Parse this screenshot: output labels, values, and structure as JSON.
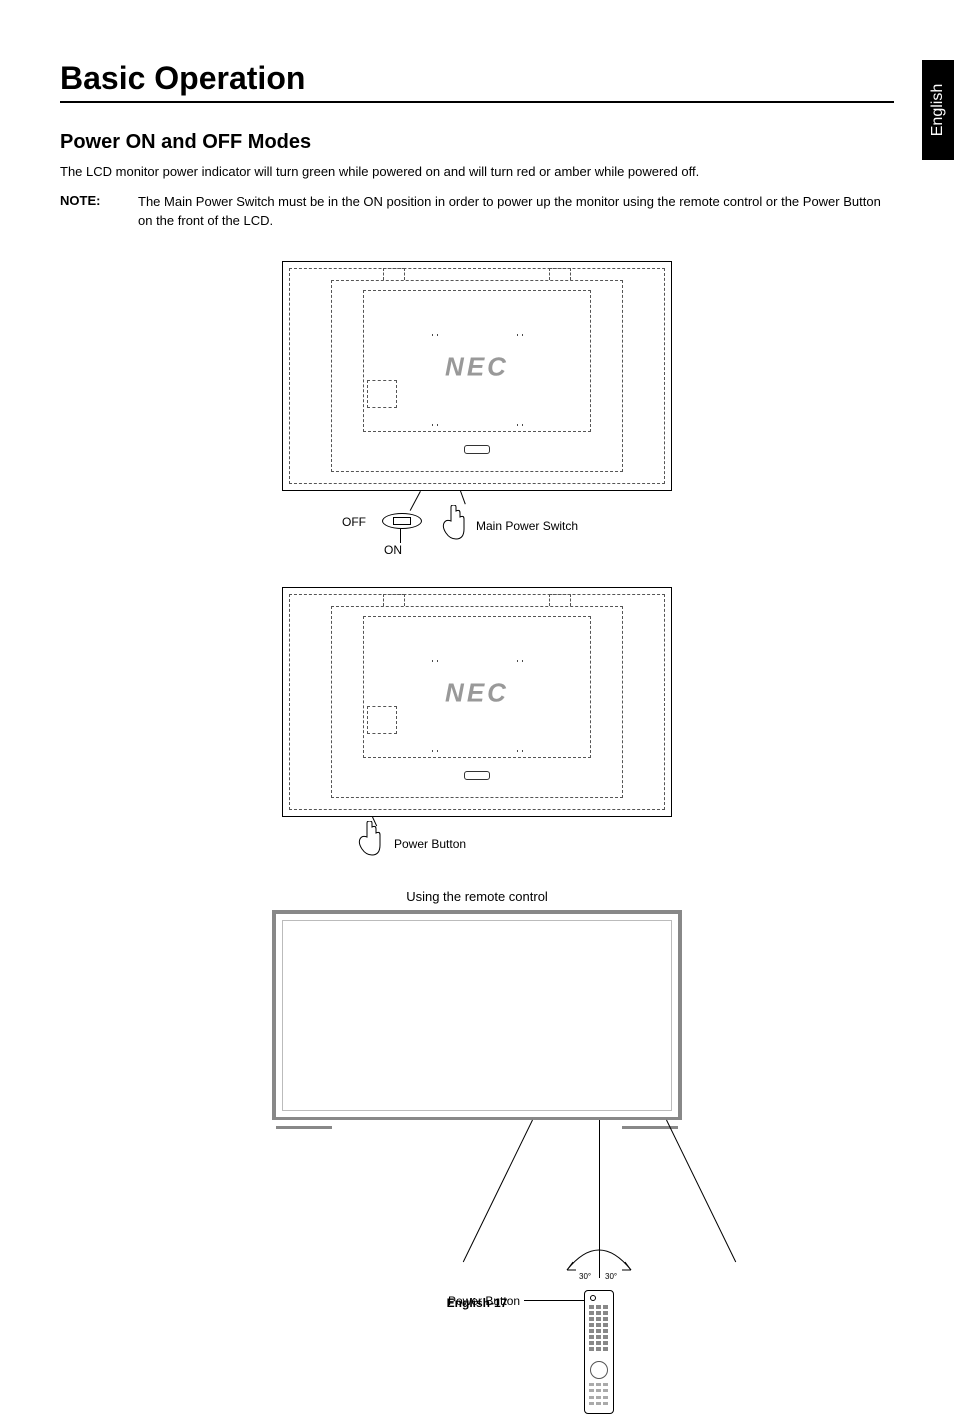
{
  "side_tab": "English",
  "page_title": "Basic Operation",
  "section_title": "Power ON and OFF Modes",
  "intro_text": "The LCD monitor power indicator will turn green while powered on and will turn red or amber while powered off.",
  "note_label": "NOTE:",
  "note_text": "The Main Power Switch must be in the ON position in order to power up the monitor using the remote control or the Power Button on the front of the LCD.",
  "figure1": {
    "logo": "NEC",
    "off_label": "OFF",
    "on_label": "ON",
    "switch_label": "Main Power Switch"
  },
  "figure2": {
    "logo": "NEC",
    "button_label": "Power Button"
  },
  "figure3": {
    "caption": "Using the remote control",
    "angle_left": "30°",
    "angle_right": "30°",
    "button_label": "Power Button"
  },
  "footer": "English-17"
}
